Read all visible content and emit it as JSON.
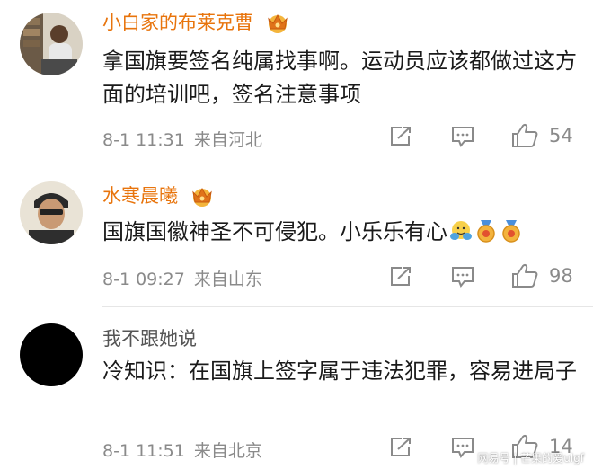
{
  "colors": {
    "vip_name": "#e8740c",
    "normal_name": "#555555",
    "meta": "#8a8a8a",
    "text": "#1a1a1a"
  },
  "comments": [
    {
      "author": "小白家的布莱克曹",
      "vip": true,
      "text": "拿国旗要签名纯属找事啊。运动员应该都做过这方面的培训吧，签名注意事项",
      "time": "8-1 11:31",
      "source": "来自河北",
      "likes": "54"
    },
    {
      "author": "水寒晨曦",
      "vip": true,
      "text": "国旗国徽神圣不可侵犯。小乐乐有心",
      "time": "8-1 09:27",
      "source": "来自山东",
      "likes": "98"
    },
    {
      "author": "我不跟她说",
      "vip": false,
      "text": "冷知识：在国旗上签字属于违法犯罪，容易进局子",
      "time": "8-1 11:51",
      "source": "来自北京",
      "likes": "14"
    }
  ],
  "watermark": "网易号 | 芒果的爱ulgf",
  "icons": [
    "crown-badge-icon",
    "share-icon",
    "reply-icon",
    "like-icon",
    "hug-emoji-icon",
    "medal-icon"
  ]
}
